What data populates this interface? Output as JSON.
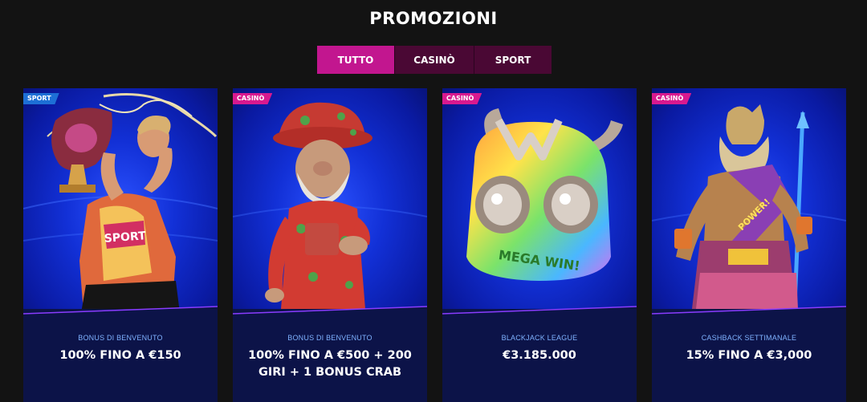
{
  "page": {
    "title": "PROMOZIONI"
  },
  "tabs": [
    {
      "label": "TUTTO",
      "active": true
    },
    {
      "label": "CASINÒ",
      "active": false
    },
    {
      "label": "SPORT",
      "active": false
    }
  ],
  "cards": [
    {
      "badge": "SPORT",
      "subtitle": "BONUS DI BENVENUTO",
      "title": "100% FINO A €150",
      "badge_color": "#1d6fd6",
      "art_icon": "footballer-trophy-icon"
    },
    {
      "badge": "CASINÒ",
      "subtitle": "BONUS DI BENVENUTO",
      "title": "100% FINO A €500 + 200 GIRI + 1 BONUS CRAB",
      "badge_color": "#d8198f",
      "art_icon": "gnome-character-icon"
    },
    {
      "badge": "CASINÒ",
      "subtitle": "BLACKJACK LEAGUE",
      "title": "€3.185.000",
      "badge_color": "#d8198f",
      "art_icon": "mega-win-helmet-icon"
    },
    {
      "badge": "CASINÒ",
      "subtitle": "CASHBACK SETTIMANALE",
      "title": "15% FINO A €3,000",
      "badge_color": "#d8198f",
      "art_icon": "zeus-character-icon"
    }
  ],
  "art_text": {
    "card1_shirt": "SPORT",
    "card3_helmet": "MEGA WIN!",
    "card4_sash": "POWER!"
  },
  "colors": {
    "background": "#131313",
    "tab_active": "#c2168f",
    "tab_inactive": "#4a0834",
    "card_bottom": "#0c1348",
    "subtitle": "#7fb2ff"
  }
}
